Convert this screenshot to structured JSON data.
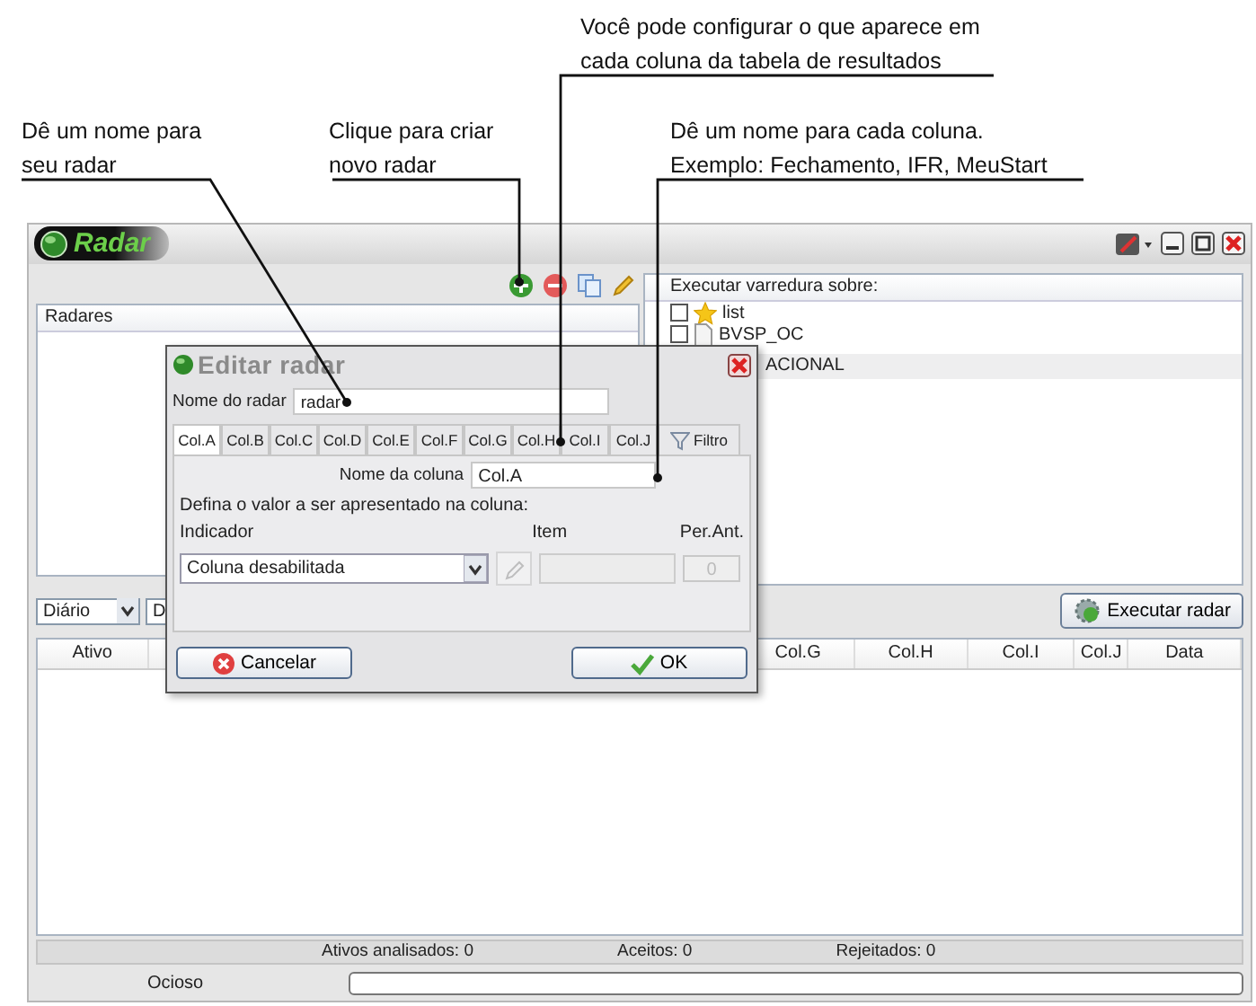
{
  "annotations": [
    {
      "text": "Dê um nome para\nseu radar"
    },
    {
      "text": "Clique para criar\nnovo radar"
    },
    {
      "text": "Você pode configurar o que aparece em\ncada coluna da tabela de resultados"
    },
    {
      "text": "Dê um nome para cada coluna.\nExemplo: Fechamento, IFR, MeuStart"
    }
  ],
  "window": {
    "title": "Radar"
  },
  "left_panel": {
    "header": "Radares"
  },
  "scan_panel": {
    "header": "Executar varredura sobre:",
    "items": [
      {
        "label": "list",
        "kind": "star",
        "checked": false,
        "selected": false
      },
      {
        "label": "BVSP_OC",
        "kind": "file",
        "checked": false,
        "selected": false
      },
      {
        "label": "ACIONAL",
        "kind": "covered",
        "selected": true
      }
    ]
  },
  "controls": {
    "period": "Diário",
    "second": "D",
    "run_button": "Executar radar"
  },
  "table": {
    "columns": [
      "Ativo",
      "Col.G",
      "Col.H",
      "Col.I",
      "Col.J",
      "Data"
    ]
  },
  "status": {
    "analyzed": "Ativos analisados: 0",
    "accepted": "Aceitos: 0",
    "rejected": "Rejeitados: 0",
    "state": "Ocioso",
    "progress": {
      "level": 0
    }
  },
  "dialog": {
    "title": "Editar radar",
    "name_label": "Nome do radar",
    "name_value": "radar",
    "tabs": [
      {
        "label": "Col.A",
        "kind": "text",
        "selected": true
      },
      {
        "label": "Col.B",
        "kind": "text",
        "selected": false
      },
      {
        "label": "Col.C",
        "kind": "text",
        "selected": false
      },
      {
        "label": "Col.D",
        "kind": "text",
        "selected": false
      },
      {
        "label": "Col.E",
        "kind": "text",
        "selected": false
      },
      {
        "label": "Col.F",
        "kind": "text",
        "selected": false
      },
      {
        "label": "Col.G",
        "kind": "text",
        "selected": false
      },
      {
        "label": "Col.H",
        "kind": "text",
        "selected": false
      },
      {
        "label": "Col.I",
        "kind": "text",
        "selected": false
      },
      {
        "label": "Col.J",
        "kind": "text",
        "selected": false
      },
      {
        "label": "Filtro",
        "kind": "filter",
        "selected": false
      }
    ],
    "column_name_label": "Nome da coluna",
    "column_name_value": "Col.A",
    "instruction": "Defina o valor a ser apresentado na coluna:",
    "indicator_label": "Indicador",
    "item_label": "Item",
    "per_label": "Per.Ant.",
    "indicator_value": "Coluna desabilitada",
    "edit_disabled": true,
    "item_disabled": true,
    "per_value": "0",
    "per_disabled": true,
    "buttons": [
      {
        "label": "Cancelar",
        "kind": "cancel"
      },
      {
        "label": "OK",
        "kind": "ok"
      }
    ]
  }
}
